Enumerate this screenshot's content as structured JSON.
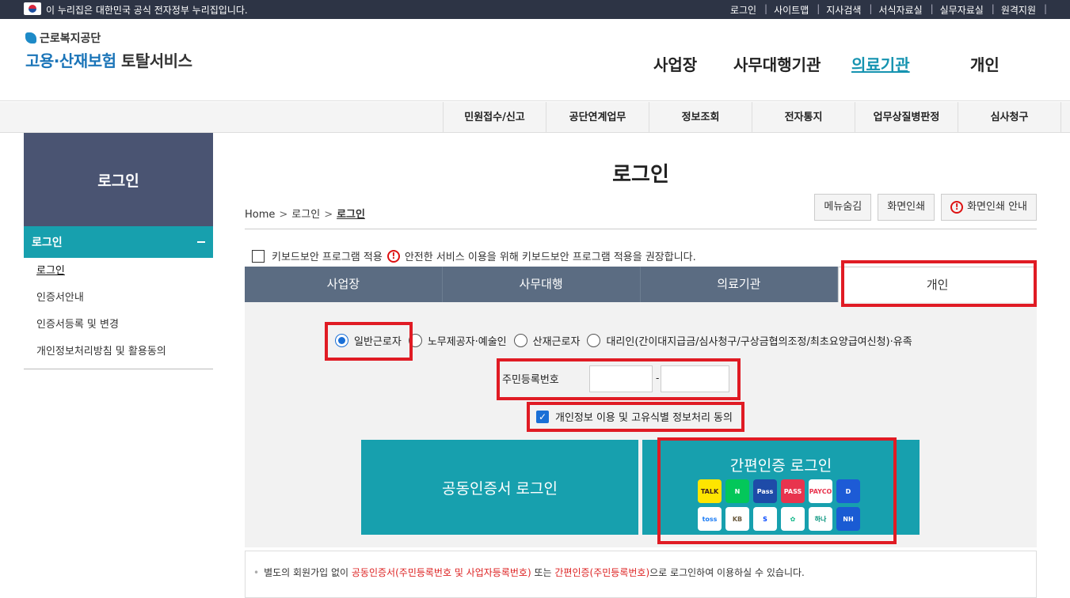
{
  "topbar": {
    "notice": "이 누리집은 대한민국 공식 전자정부 누리집입니다.",
    "links": [
      "로그인",
      "사이트맵",
      "지사검색",
      "서식자료실",
      "실무자료실",
      "원격지원"
    ]
  },
  "logo": {
    "org": "근로복지공단",
    "service_a": "고용·산재보험",
    "service_b": "토탈서비스"
  },
  "gnb": [
    "사업장",
    "사무대행기관",
    "의료기관",
    "개인"
  ],
  "subnav": [
    "민원접수/신고",
    "공단연계업무",
    "정보조회",
    "전자통지",
    "업무상질병판정",
    "심사청구"
  ],
  "lnb": {
    "title": "로그인",
    "section": "로그인",
    "items": [
      "로그인",
      "인증서안내",
      "인증서등록 및 변경",
      "개인정보처리방침 및 활용동의"
    ]
  },
  "page": {
    "title": "로그인"
  },
  "breadcrumb": [
    "Home",
    "로그인",
    "로그인"
  ],
  "util_buttons": [
    "메뉴숨김",
    "화면인쇄",
    "화면인쇄 안내"
  ],
  "keyboard_security": {
    "label": "키보드보안 프로그램 적용",
    "notice": "안전한 서비스 이용을 위해 키보드보안 프로그램 적용을 권장합니다."
  },
  "tabs": [
    "사업장",
    "사무대행",
    "의료기관",
    "개인"
  ],
  "radios": [
    "일반근로자",
    "노무제공자·예술인",
    "산재근로자",
    "대리인(간이대지급금/심사청구/구상금협의조정/최초요양급여신청)·유족"
  ],
  "rrn": {
    "label": "주민등록번호",
    "dash": "-"
  },
  "agree": {
    "label": "개인정보 이용 및 고유식별 정보처리 동의"
  },
  "cert_login": "공동인증서 로그인",
  "simple_login": {
    "title": "간편인증 로그인",
    "providers": [
      {
        "label": "TALK",
        "bg": "#fee500",
        "fg": "#3c1e1e"
      },
      {
        "label": "N",
        "bg": "#03c75a",
        "fg": "#ffffff"
      },
      {
        "label": "Pass",
        "bg": "#1e4ba8",
        "fg": "#ffffff"
      },
      {
        "label": "PASS",
        "bg": "#e8344e",
        "fg": "#ffffff"
      },
      {
        "label": "PAYCO",
        "bg": "#ffffff",
        "fg": "#e8344e"
      },
      {
        "label": "D",
        "bg": "#1d5bd6",
        "fg": "#ffffff"
      },
      {
        "label": "toss",
        "bg": "#ffffff",
        "fg": "#1b7cf5"
      },
      {
        "label": "KB",
        "bg": "#ffffff",
        "fg": "#6b5a3e"
      },
      {
        "label": "S",
        "bg": "#ffffff",
        "fg": "#0046ff"
      },
      {
        "label": "✿",
        "bg": "#ffffff",
        "fg": "#14b88a"
      },
      {
        "label": "하나",
        "bg": "#ffffff",
        "fg": "#00927a"
      },
      {
        "label": "NH",
        "bg": "#1a5bd3",
        "fg": "#ffffff"
      }
    ]
  },
  "info": {
    "p1": "별도의 회원가입 없이 ",
    "red1": "공동인증서(주민등록번호 및 사업자등록번호)",
    "p2": " 또는 ",
    "red2": "간편인증(주민등록번호)",
    "p3": "으로 로그인하여 이용하실 수 있습니다."
  },
  "colors": {
    "teal": "#17a0ae",
    "navy": "#4a5472",
    "tab": "#5b6c82",
    "highlight": "#e01b24"
  }
}
